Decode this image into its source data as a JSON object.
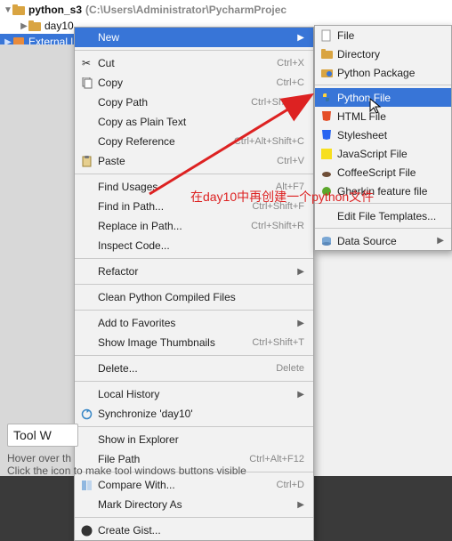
{
  "tree": {
    "project_name": "python_s3",
    "project_path": "(C:\\Users\\Administrator\\PycharmProjec",
    "folder": "day10",
    "external": "External l"
  },
  "context_menu": {
    "new": "New",
    "cut": "Cut",
    "cut_sc": "Ctrl+X",
    "copy": "Copy",
    "copy_sc": "Ctrl+C",
    "copy_path": "Copy Path",
    "copy_path_sc": "Ctrl+Shift+C",
    "copy_plain": "Copy as Plain Text",
    "copy_ref": "Copy Reference",
    "copy_ref_sc": "Ctrl+Alt+Shift+C",
    "paste": "Paste",
    "paste_sc": "Ctrl+V",
    "find_usages": "Find Usages",
    "find_usages_sc": "Alt+F7",
    "find_in_path": "Find in Path...",
    "find_in_path_sc": "Ctrl+Shift+F",
    "replace_in_path": "Replace in Path...",
    "replace_in_path_sc": "Ctrl+Shift+R",
    "inspect": "Inspect Code...",
    "refactor": "Refactor",
    "clean_python": "Clean Python Compiled Files",
    "add_fav": "Add to Favorites",
    "show_thumbnails": "Show Image Thumbnails",
    "show_thumbnails_sc": "Ctrl+Shift+T",
    "delete": "Delete...",
    "delete_sc": "Delete",
    "local_history": "Local History",
    "synchronize": "Synchronize 'day10'",
    "show_explorer": "Show in Explorer",
    "file_path": "File Path",
    "file_path_sc": "Ctrl+Alt+F12",
    "compare": "Compare With...",
    "compare_sc": "Ctrl+D",
    "mark_dir": "Mark Directory As",
    "create_gist": "Create Gist..."
  },
  "submenu": {
    "file": "File",
    "directory": "Directory",
    "python_package": "Python Package",
    "python_file": "Python File",
    "html_file": "HTML File",
    "stylesheet": "Stylesheet",
    "javascript_file": "JavaScript File",
    "coffeescript_file": "CoffeeScript File",
    "gherkin_feature": "Gherkin feature file",
    "edit_templates": "Edit File Templates...",
    "data_source": "Data Source"
  },
  "tool_window": {
    "title": "Tool W",
    "hint1": "Hover over th",
    "hint2": "Click the icon to make tool windows buttons visible"
  },
  "annotation": "在day10中再创建一个python文件"
}
